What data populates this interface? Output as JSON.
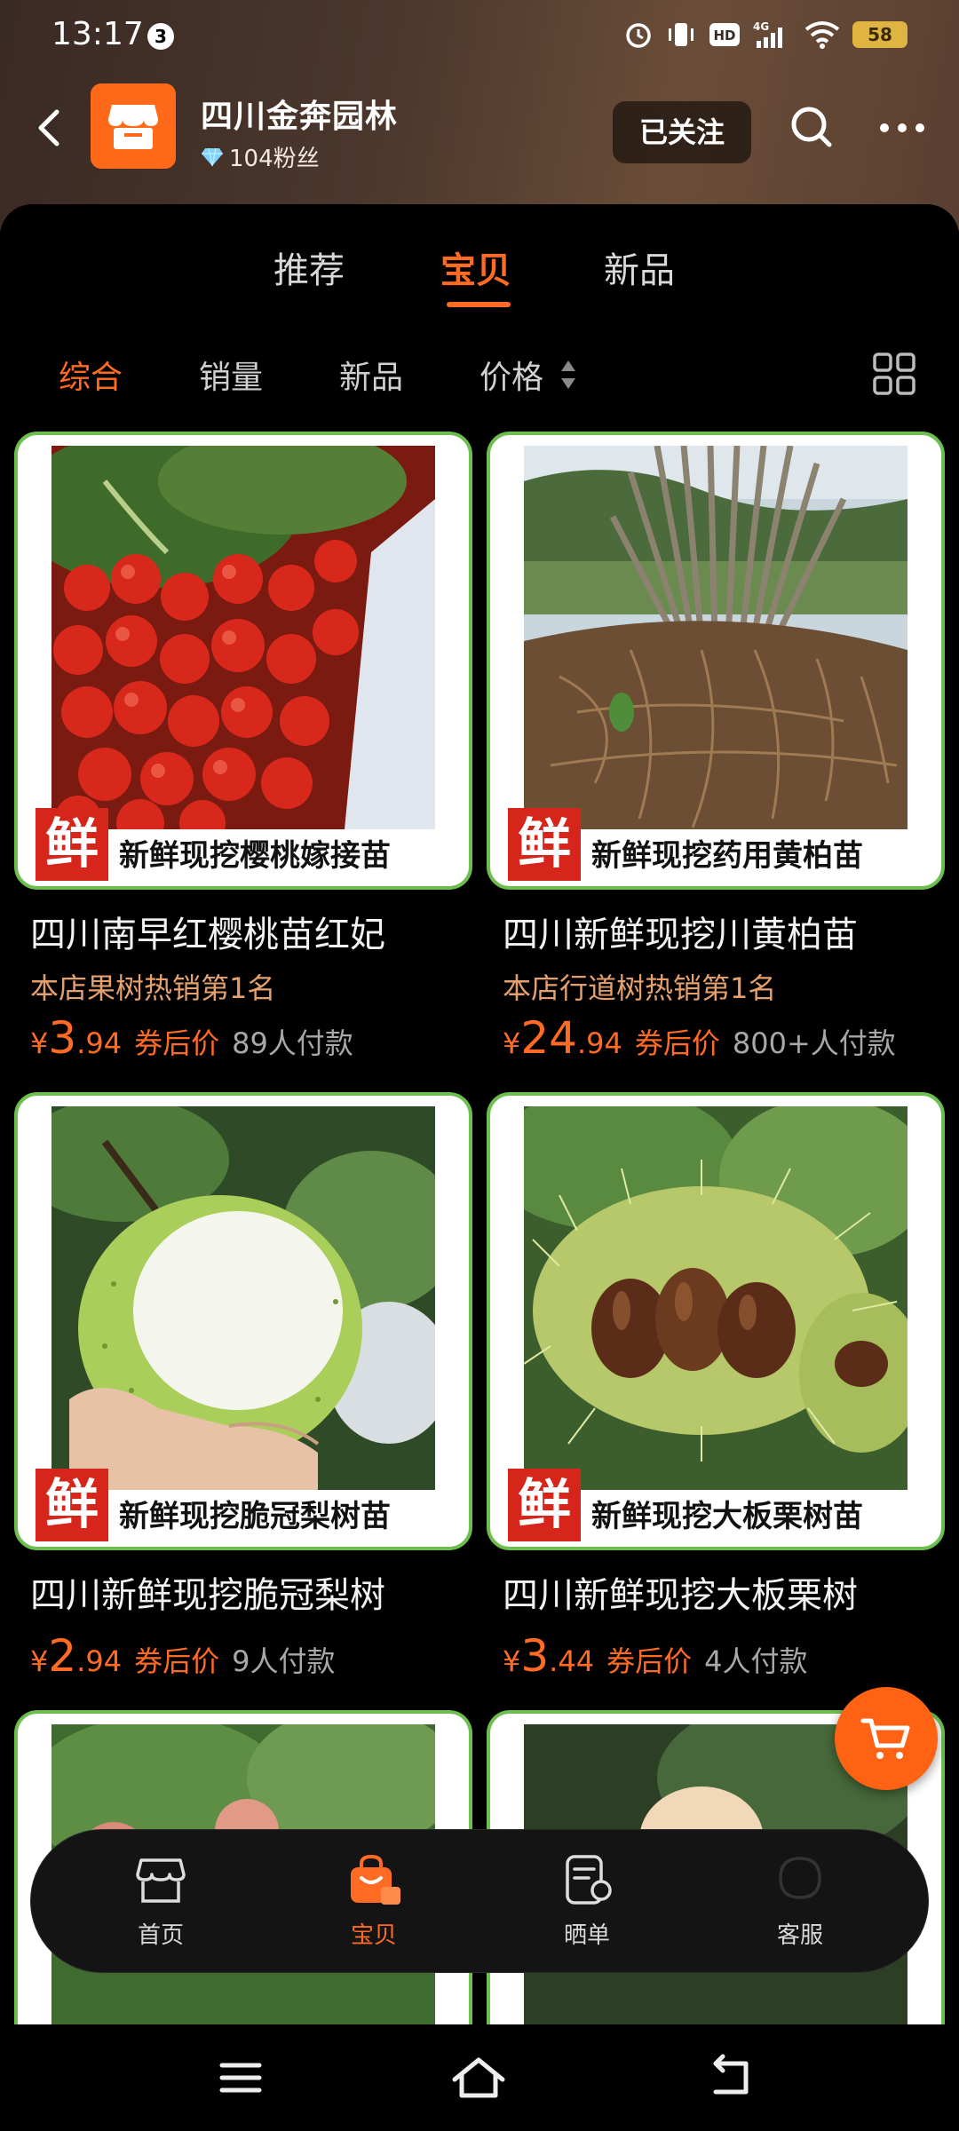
{
  "status_bar": {
    "time": "13:17",
    "notification_count": "3",
    "battery": "58",
    "network": "4G",
    "hd": "HD"
  },
  "shop": {
    "name": "四川金奔园林",
    "fans": "104粉丝",
    "follow_label": "已关注"
  },
  "main_tabs": [
    {
      "label": "推荐",
      "active": false
    },
    {
      "label": "宝贝",
      "active": true
    },
    {
      "label": "新品",
      "active": false
    }
  ],
  "sort_options": [
    {
      "label": "综合",
      "active": true
    },
    {
      "label": "销量",
      "active": false
    },
    {
      "label": "新品",
      "active": false
    },
    {
      "label": "价格",
      "active": false
    }
  ],
  "products": [
    {
      "banner_fresh": "鲜",
      "banner_text": "新鲜现挖樱桃嫁接苗",
      "title": "四川南早红樱桃苗红妃",
      "tag": "本店果树热销第1名",
      "price_symbol": "¥",
      "price_int": "3",
      "price_dec": ".94",
      "price_label": "券后价",
      "sales": "89人付款"
    },
    {
      "banner_fresh": "鲜",
      "banner_text": "新鲜现挖药用黄柏苗",
      "title": "四川新鲜现挖川黄柏苗",
      "tag": "本店行道树热销第1名",
      "price_symbol": "¥",
      "price_int": "24",
      "price_dec": ".94",
      "price_label": "券后价",
      "sales": "800+人付款"
    },
    {
      "banner_fresh": "鲜",
      "banner_text": "新鲜现挖脆冠梨树苗",
      "title": "四川新鲜现挖脆冠梨树",
      "tag": "",
      "price_symbol": "¥",
      "price_int": "2",
      "price_dec": ".94",
      "price_label": "券后价",
      "sales": "9人付款"
    },
    {
      "banner_fresh": "鲜",
      "banner_text": "新鲜现挖大板栗树苗",
      "title": "四川新鲜现挖大板栗树",
      "tag": "",
      "price_symbol": "¥",
      "price_int": "3",
      "price_dec": ".44",
      "price_label": "券后价",
      "sales": "4人付款"
    }
  ],
  "bottom_nav": [
    {
      "label": "首页",
      "icon": "home-shop-icon",
      "active": false
    },
    {
      "label": "宝贝",
      "icon": "bag-icon",
      "active": true
    },
    {
      "label": "晒单",
      "icon": "review-icon",
      "active": false
    },
    {
      "label": "客服",
      "icon": "service-icon",
      "active": false
    }
  ],
  "colors": {
    "accent": "#ff6b22",
    "frame_green": "#6cbf4f",
    "fresh_red": "#d6251a"
  }
}
